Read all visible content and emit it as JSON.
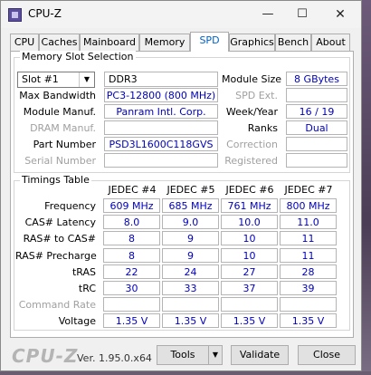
{
  "window": {
    "title": "CPU-Z",
    "min": "—",
    "max": "☐",
    "close": "✕"
  },
  "tabs": [
    "CPU",
    "Caches",
    "Mainboard",
    "Memory",
    "SPD",
    "Graphics",
    "Bench",
    "About"
  ],
  "slot": {
    "group_title": "Memory Slot Selection",
    "selected": "Slot #1",
    "type": "DDR3",
    "labels": {
      "max_bandwidth": "Max Bandwidth",
      "module_manuf": "Module Manuf.",
      "dram_manuf": "DRAM Manuf.",
      "part_number": "Part Number",
      "serial_number": "Serial Number",
      "module_size": "Module Size",
      "spd_ext": "SPD Ext.",
      "week_year": "Week/Year",
      "ranks": "Ranks",
      "correction": "Correction",
      "registered": "Registered"
    },
    "values": {
      "max_bandwidth": "PC3-12800 (800 MHz)",
      "module_manuf": "Panram Intl. Corp.",
      "part_number": "PSD3L1600C118GVS",
      "module_size": "8 GBytes",
      "week_year": "16 / 19",
      "ranks": "Dual"
    }
  },
  "timings": {
    "group_title": "Timings Table",
    "columns": [
      "JEDEC #4",
      "JEDEC #5",
      "JEDEC #6",
      "JEDEC #7"
    ],
    "rows": [
      {
        "label": "Frequency",
        "values": [
          "609 MHz",
          "685 MHz",
          "761 MHz",
          "800 MHz"
        ]
      },
      {
        "label": "CAS# Latency",
        "values": [
          "8.0",
          "9.0",
          "10.0",
          "11.0"
        ]
      },
      {
        "label": "RAS# to CAS#",
        "values": [
          "8",
          "9",
          "10",
          "11"
        ]
      },
      {
        "label": "RAS# Precharge",
        "values": [
          "8",
          "9",
          "10",
          "11"
        ]
      },
      {
        "label": "tRAS",
        "values": [
          "22",
          "24",
          "27",
          "28"
        ]
      },
      {
        "label": "tRC",
        "values": [
          "30",
          "33",
          "37",
          "39"
        ]
      },
      {
        "label": "Command Rate",
        "values": [
          "",
          "",
          "",
          ""
        ]
      },
      {
        "label": "Voltage",
        "values": [
          "1.35 V",
          "1.35 V",
          "1.35 V",
          "1.35 V"
        ]
      }
    ]
  },
  "footer": {
    "logo": "CPU-Z",
    "version": "Ver. 1.95.0.x64",
    "tools": "Tools",
    "tools_arrow": "▼",
    "validate": "Validate",
    "close": "Close"
  }
}
